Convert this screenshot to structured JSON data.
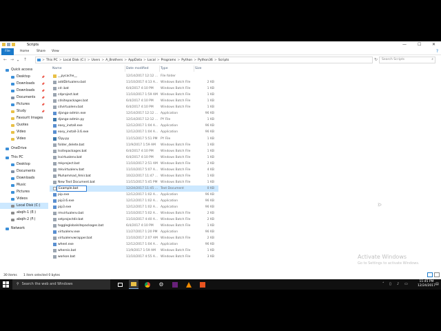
{
  "window": {
    "title": "Scripts",
    "minimize": "—",
    "maximize": "☐",
    "close": "✕"
  },
  "ribbon": {
    "file": "File",
    "tabs": [
      "Home",
      "Share",
      "View"
    ],
    "help": "?"
  },
  "address": {
    "crumbs": [
      "This PC",
      "Local Disk (C:)",
      "Users",
      "A_Brothers",
      "AppData",
      "Local",
      "Programs",
      "Python",
      "Python36",
      "Scripts"
    ],
    "separator": ">",
    "refresh": "↻"
  },
  "search": {
    "placeholder": "Search Scripts"
  },
  "nav": {
    "quick_access": "Quick access",
    "items": [
      {
        "label": "Desktop",
        "pinned": true,
        "color": "#3b8fd9"
      },
      {
        "label": "Downloads",
        "pinned": true,
        "color": "#3b8fd9"
      },
      {
        "label": "Downloads",
        "pinned": true,
        "color": "#3b8fd9"
      },
      {
        "label": "Documents",
        "pinned": true,
        "color": "#7f8fa6"
      },
      {
        "label": "Pictures",
        "pinned": true,
        "color": "#3b8fd9"
      },
      {
        "label": "Study",
        "pinned": true,
        "color": "#e8c046"
      },
      {
        "label": "Favourit Images",
        "pinned": false,
        "color": "#e8c046"
      },
      {
        "label": "Quotes",
        "pinned": false,
        "color": "#e8c046"
      },
      {
        "label": "Video",
        "pinned": false,
        "color": "#e8c046"
      },
      {
        "label": "Video",
        "pinned": false,
        "color": "#e8c046"
      }
    ],
    "onedrive": "OneDrive",
    "this_pc": "This PC",
    "pc_items": [
      {
        "label": "Desktop",
        "color": "#3b8fd9"
      },
      {
        "label": "Documents",
        "color": "#7f8fa6"
      },
      {
        "label": "Downloads",
        "color": "#3b8fd9"
      },
      {
        "label": "Music",
        "color": "#3b8fd9"
      },
      {
        "label": "Pictures",
        "color": "#3b8fd9"
      },
      {
        "label": "Videos",
        "color": "#3b8fd9"
      },
      {
        "label": "Local Disk (C:)",
        "color": "#8c8c8c"
      },
      {
        "label": "abqih-1 (E:)",
        "color": "#8c8c8c"
      },
      {
        "label": "abqih-2 (F:)",
        "color": "#8c8c8c"
      }
    ],
    "network": "Network"
  },
  "columns": {
    "name": "Name",
    "date": "Date modified",
    "type": "Type",
    "size": "Size"
  },
  "files": [
    {
      "name": "__pycache__",
      "date": "12/14/2017 12:12 ...",
      "type": "File folder",
      "size": "",
      "icon": "folder"
    },
    {
      "name": "addDirtualenv.bat",
      "date": "11/10/2017 4:13 A...",
      "type": "Windows Batch File",
      "size": "2 KB",
      "icon": "bat"
    },
    {
      "name": "cd-.bat",
      "date": "6/4/2017 4:10 PM",
      "type": "Windows Batch File",
      "size": "1 KB",
      "icon": "bat"
    },
    {
      "name": "cdproject.bat",
      "date": "11/10/2017 1:59 AM",
      "type": "Windows Batch File",
      "size": "1 KB",
      "icon": "bat"
    },
    {
      "name": "cdsitepackages.bat",
      "date": "6/4/2017 4:10 PM",
      "type": "Windows Batch File",
      "size": "1 KB",
      "icon": "bat"
    },
    {
      "name": "cdvirtualenv.bat",
      "date": "6/4/2017 4:10 PM",
      "type": "Windows Batch File",
      "size": "1 KB",
      "icon": "bat"
    },
    {
      "name": "django-admin.exe",
      "date": "12/14/2017 12:12 ...",
      "type": "Application",
      "size": "96 KB",
      "icon": "exe"
    },
    {
      "name": "django-admin.py",
      "date": "12/14/2017 12:12 ...",
      "type": "PY File",
      "size": "1 KB",
      "icon": "py"
    },
    {
      "name": "easy_install.exe",
      "date": "12/12/2017 1:04 A...",
      "type": "Application",
      "size": "96 KB",
      "icon": "exe"
    },
    {
      "name": "easy_install-3.6.exe",
      "date": "12/12/2017 1:04 A...",
      "type": "Application",
      "size": "96 KB",
      "icon": "exe"
    },
    {
      "name": "f2py.py",
      "date": "11/15/2017 5:51 PM",
      "type": "PY File",
      "size": "1 KB",
      "icon": "py"
    },
    {
      "name": "folder_delete.bat",
      "date": "11/9/2017 1:59 AM",
      "type": "Windows Batch File",
      "size": "1 KB",
      "icon": "bat"
    },
    {
      "name": "lssitepackages.bat",
      "date": "6/4/2017 4:10 PM",
      "type": "Windows Batch File",
      "size": "1 KB",
      "icon": "bat"
    },
    {
      "name": "lsvirtualenv.bat",
      "date": "6/4/2017 4:10 PM",
      "type": "Windows Batch File",
      "size": "1 KB",
      "icon": "bat"
    },
    {
      "name": "mkproject.bat",
      "date": "11/10/2017 2:51 AM",
      "type": "Windows Batch File",
      "size": "2 KB",
      "icon": "bat"
    },
    {
      "name": "mkvirtualenv.bat",
      "date": "11/10/2017 5:07 A...",
      "type": "Windows Batch File",
      "size": "4 KB",
      "icon": "bat"
    },
    {
      "name": "Muhammad_Amir.bat",
      "date": "10/22/2017 11:47 ...",
      "type": "Windows Batch File",
      "size": "1 KB",
      "icon": "bat"
    },
    {
      "name": "New Text Document.bat",
      "date": "11/15/2017 5:45 PM",
      "type": "Windows Batch File",
      "size": "1 KB",
      "icon": "bat"
    },
    {
      "name": "Example.bat",
      "date": "12/24/2017 11:45 ...",
      "type": "Text Document",
      "size": "0 KB",
      "icon": "txt",
      "selected": true,
      "renaming": true
    },
    {
      "name": "pip.exe",
      "date": "12/12/2017 1:02 A...",
      "type": "Application",
      "size": "96 KB",
      "icon": "exe"
    },
    {
      "name": "pip3.6.exe",
      "date": "12/12/2017 1:02 A...",
      "type": "Application",
      "size": "96 KB",
      "icon": "exe"
    },
    {
      "name": "pip3.exe",
      "date": "12/12/2017 1:02 A...",
      "type": "Application",
      "size": "96 KB",
      "icon": "exe"
    },
    {
      "name": "rmvirtualenv.bat",
      "date": "11/10/2017 5:02 A...",
      "type": "Windows Batch File",
      "size": "2 KB",
      "icon": "bat"
    },
    {
      "name": "setprojectdir.bat",
      "date": "11/10/2017 4:40 A...",
      "type": "Windows Batch File",
      "size": "2 KB",
      "icon": "bat"
    },
    {
      "name": "toggleglobalsitepackages.bat",
      "date": "6/4/2017 4:10 PM",
      "type": "Windows Batch File",
      "size": "1 KB",
      "icon": "bat"
    },
    {
      "name": "virtualenv.exe",
      "date": "11/27/2017 1:20 PM",
      "type": "Application",
      "size": "96 KB",
      "icon": "exe"
    },
    {
      "name": "virtualenvwrapper.bat",
      "date": "11/10/2017 2:07 AM",
      "type": "Windows Batch File",
      "size": "2 KB",
      "icon": "bat"
    },
    {
      "name": "wheel.exe",
      "date": "12/12/2017 1:04 A...",
      "type": "Application",
      "size": "96 KB",
      "icon": "exe"
    },
    {
      "name": "whereis.bat",
      "date": "11/9/2017 1:59 AM",
      "type": "Windows Batch File",
      "size": "1 KB",
      "icon": "bat"
    },
    {
      "name": "workon.bat",
      "date": "11/10/2017 4:55 A...",
      "type": "Windows Batch File",
      "size": "3 KB",
      "icon": "bat"
    }
  ],
  "status": {
    "count": "30 items",
    "selected": "1 item selected  0 bytes"
  },
  "watermark": {
    "line1": "Activate Windows",
    "line2": "Go to Settings to activate Windows."
  },
  "taskbar": {
    "search_placeholder": "Search the web and Windows",
    "time": "11:45 PM",
    "date": "12/24/2017"
  },
  "colors": {
    "accent": "#1979ca",
    "selection": "#cce8ff",
    "folder": "#e8c046",
    "taskbar": "#101010"
  }
}
